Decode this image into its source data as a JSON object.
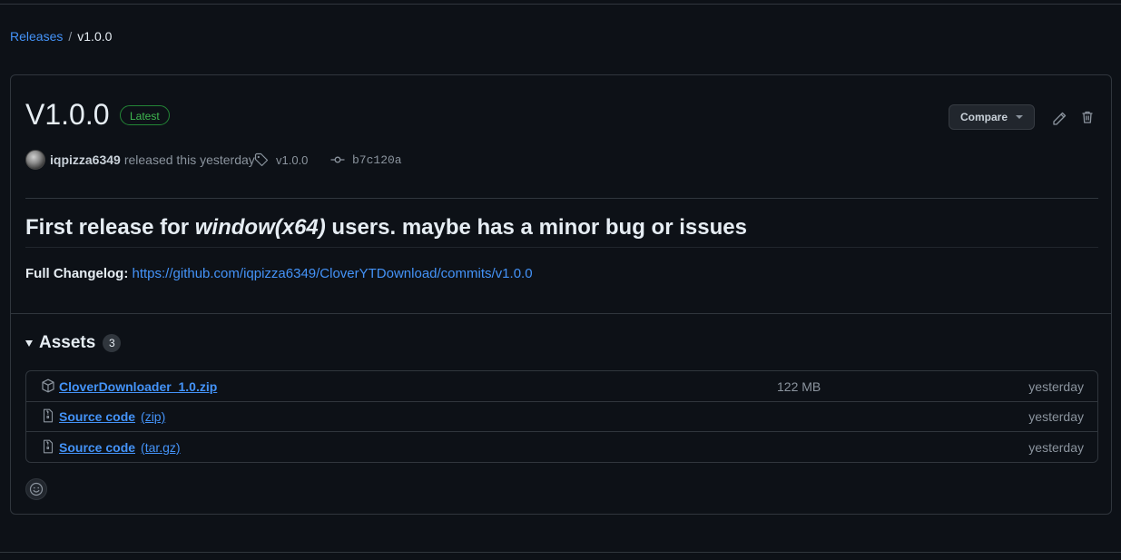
{
  "breadcrumb": {
    "releases": "Releases",
    "separator": "/",
    "current": "v1.0.0"
  },
  "release": {
    "title": "V1.0.0",
    "badge": "Latest",
    "compare_label": "Compare",
    "author": "iqpizza6349",
    "released_text": "released this yesterday",
    "tag": "v1.0.0",
    "commit": "b7c120a",
    "heading_prefix": "First release for ",
    "heading_emphasis": "window(x64)",
    "heading_suffix": " users. maybe has a minor bug or issues",
    "changelog_label": "Full Changelog:",
    "changelog_link": "https://github.com/iqpizza6349/CloverYTDownload/commits/v1.0.0"
  },
  "assets": {
    "title": "Assets",
    "count": "3",
    "items": [
      {
        "name": "CloverDownloader_1.0.zip",
        "suffix": "",
        "size": "122 MB",
        "date": "yesterday",
        "icon": "package-icon"
      },
      {
        "name": "Source code",
        "suffix": "(zip)",
        "size": "",
        "date": "yesterday",
        "icon": "file-zip-icon"
      },
      {
        "name": "Source code",
        "suffix": "(tar.gz)",
        "size": "",
        "date": "yesterday",
        "icon": "file-zip-icon"
      }
    ]
  },
  "colors": {
    "link": "#4493f8",
    "badge_green": "#3fb950",
    "background": "#0d1117",
    "border": "#30363d"
  }
}
